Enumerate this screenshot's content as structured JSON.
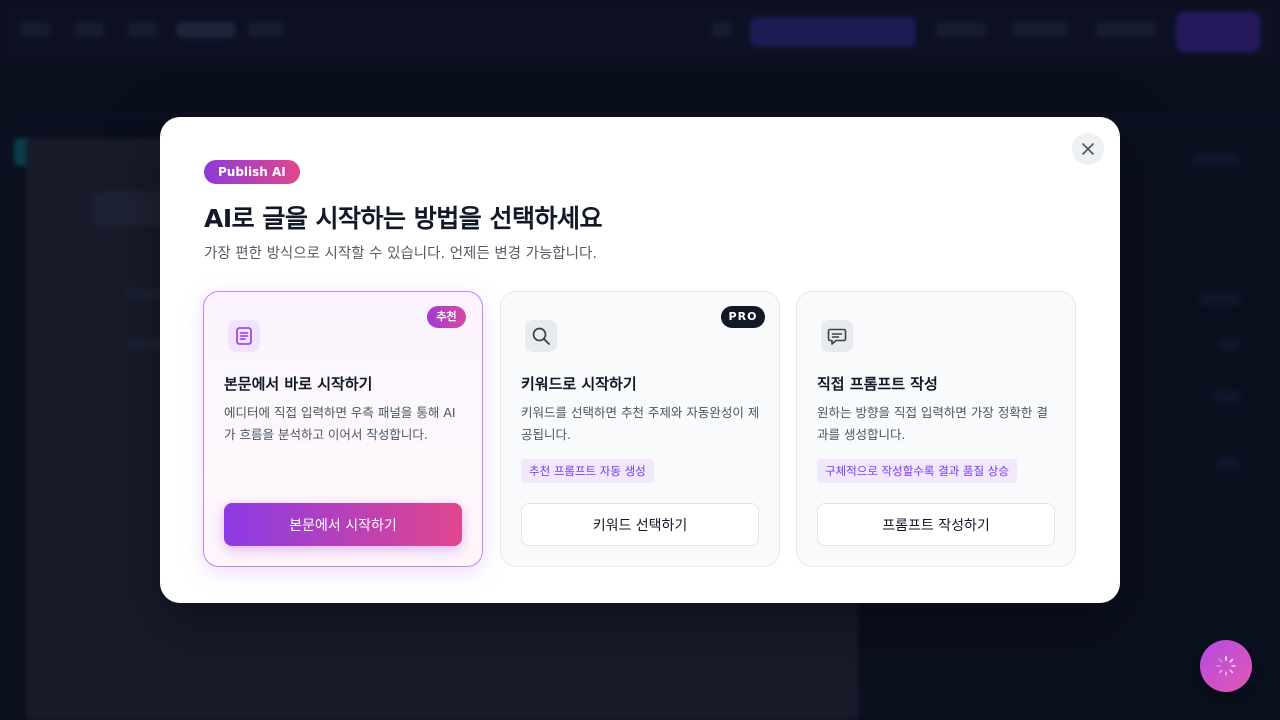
{
  "modal": {
    "brand_badge": "Publish AI",
    "title": "AI로 글을 시작하는 방법을 선택하세요",
    "subtitle": "가장 편한 방식으로 시작할 수 있습니다. 언제든 변경 가능합니다.",
    "close_icon": "close-icon",
    "options": [
      {
        "badge": "추천",
        "icon": "document-icon",
        "title": "본문에서 바로 시작하기",
        "description": "에디터에 직접 입력하면 우측 패널을 통해 AI가 흐름을 분석하고 이어서 작성합니다.",
        "tag": "",
        "button": "본문에서 시작하기",
        "selected": true
      },
      {
        "badge": "PRO",
        "icon": "search-icon",
        "title": "키워드로 시작하기",
        "description": "키워드를 선택하면 추천 주제와 자동완성이 제공됩니다.",
        "tag": "추천 프롬프트 자동 생성",
        "button": "키워드 선택하기",
        "selected": false
      },
      {
        "badge": "",
        "icon": "chat-icon",
        "title": "직접 프롬프트 작성",
        "description": "원하는 방향을 직접 입력하면 가장 정확한 결과를 생성합니다.",
        "tag": "구체적으로 작성할수록 결과 품질 상승",
        "button": "프롬프트 작성하기",
        "selected": false
      }
    ]
  },
  "floating_button": {
    "icon": "loading-spinner-icon"
  },
  "colors": {
    "accent_start": "#8b3be6",
    "accent_end": "#e1468e",
    "pro_badge": "#111827",
    "tag_bg": "#f1e8fd",
    "tag_text": "#7c3aed"
  }
}
